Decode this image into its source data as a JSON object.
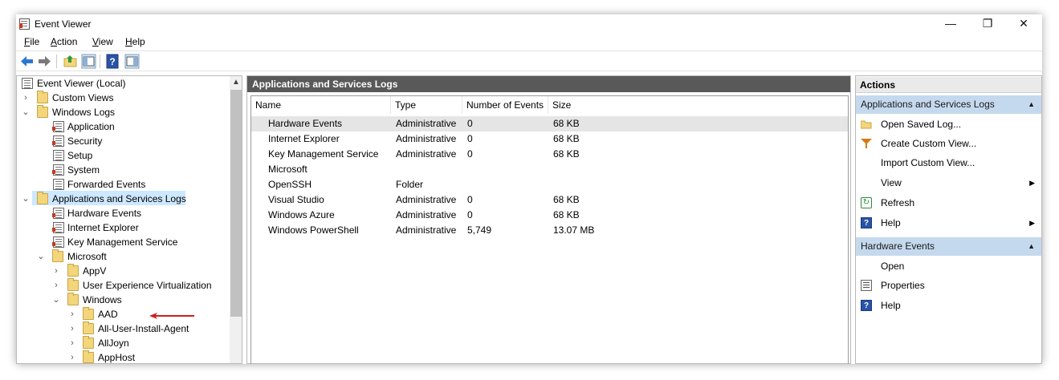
{
  "window": {
    "title": "Event Viewer",
    "controls": {
      "minimize": "—",
      "maximize": "❐",
      "close": "✕"
    }
  },
  "menu": {
    "file": {
      "u": "F",
      "rest": "ile"
    },
    "action": {
      "u": "A",
      "rest": "ction"
    },
    "view": {
      "u": "V",
      "rest": "iew"
    },
    "help": {
      "u": "H",
      "rest": "elp"
    }
  },
  "tree": {
    "items": [
      {
        "label": "Event Viewer (Local)"
      },
      {
        "label": "Custom Views"
      },
      {
        "label": "Windows Logs"
      },
      {
        "label": "Application"
      },
      {
        "label": "Security"
      },
      {
        "label": "Setup"
      },
      {
        "label": "System"
      },
      {
        "label": "Forwarded Events"
      },
      {
        "label": "Applications and Services Logs"
      },
      {
        "label": "Hardware Events"
      },
      {
        "label": "Internet Explorer"
      },
      {
        "label": "Key Management Service"
      },
      {
        "label": "Microsoft"
      },
      {
        "label": "AppV"
      },
      {
        "label": "User Experience Virtualization"
      },
      {
        "label": "Windows"
      },
      {
        "label": "AAD"
      },
      {
        "label": "All-User-Install-Agent"
      },
      {
        "label": "AllJoyn"
      },
      {
        "label": "AppHost"
      }
    ]
  },
  "center": {
    "header": "Applications and Services Logs",
    "columns": {
      "name": "Name",
      "type": "Type",
      "events": "Number of Events",
      "size": "Size"
    },
    "rows": [
      {
        "name": "Hardware Events",
        "type": "Administrative",
        "events": "0",
        "size": "68 KB"
      },
      {
        "name": "Internet Explorer",
        "type": "Administrative",
        "events": "0",
        "size": "68 KB"
      },
      {
        "name": "Key Management Service",
        "type": "Administrative",
        "events": "0",
        "size": "68 KB"
      },
      {
        "name": "Microsoft",
        "type": "",
        "events": "",
        "size": ""
      },
      {
        "name": "OpenSSH",
        "type": "Folder",
        "events": "",
        "size": ""
      },
      {
        "name": "Visual Studio",
        "type": "Administrative",
        "events": "0",
        "size": "68 KB"
      },
      {
        "name": "Windows Azure",
        "type": "Administrative",
        "events": "0",
        "size": "68 KB"
      },
      {
        "name": "Windows PowerShell",
        "type": "Administrative",
        "events": "5,749",
        "size": "13.07 MB"
      }
    ]
  },
  "actions": {
    "header": "Actions",
    "section1": "Applications and Services Logs",
    "items1": {
      "open_saved": "Open Saved Log...",
      "create_custom": "Create Custom View...",
      "import_custom": "Import Custom View...",
      "view": "View",
      "refresh": "Refresh",
      "help": "Help"
    },
    "section2": "Hardware Events",
    "items2": {
      "open": "Open",
      "properties": "Properties",
      "help": "Help"
    }
  },
  "colors": {
    "selection": "#cde8ff",
    "section": "#c5d9ee",
    "header_dark": "#595959",
    "arrow": "#cc1f1f"
  },
  "icons": {
    "back": "arrow-left-icon",
    "forward": "arrow-right-icon",
    "help": "help-icon"
  }
}
